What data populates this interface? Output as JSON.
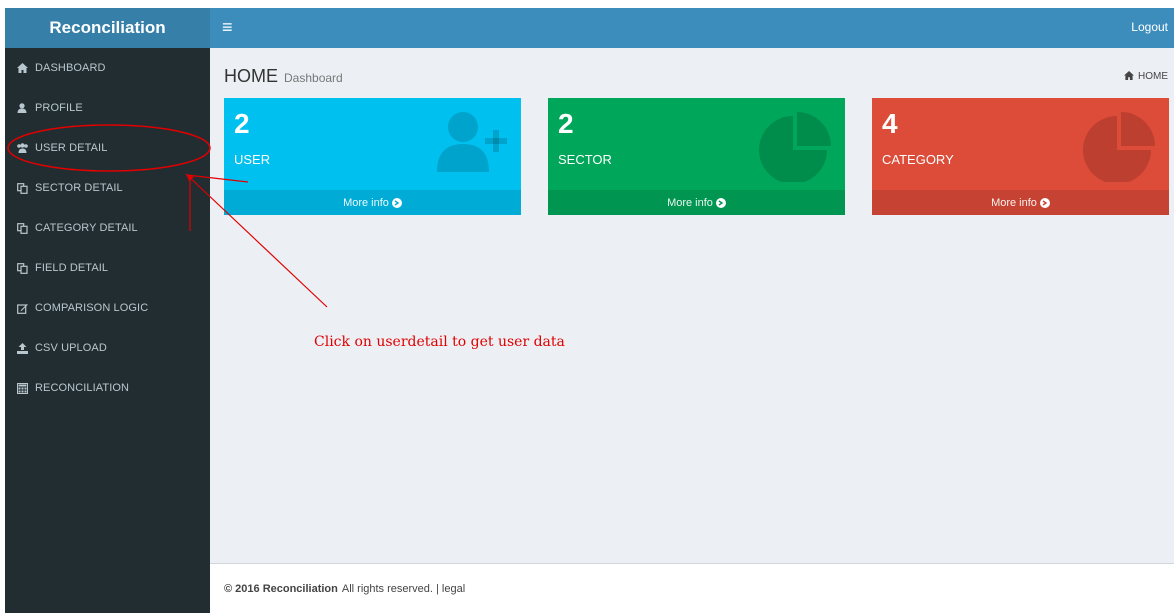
{
  "app": {
    "title": "Reconciliation"
  },
  "topbar": {
    "menu_icon": "hamburger-icon",
    "logout_label": "Logout"
  },
  "sidebar": {
    "items": [
      {
        "label": "DASHBOARD",
        "icon": "home-icon"
      },
      {
        "label": "PROFILE",
        "icon": "user-icon"
      },
      {
        "label": "USER DETAIL",
        "icon": "users-icon"
      },
      {
        "label": "SECTOR DETAIL",
        "icon": "copy-icon"
      },
      {
        "label": "CATEGORY DETAIL",
        "icon": "copy-icon"
      },
      {
        "label": "FIELD DETAIL",
        "icon": "copy-icon"
      },
      {
        "label": "COMPARISON LOGIC",
        "icon": "edit-icon"
      },
      {
        "label": "CSV UPLOAD",
        "icon": "upload-icon"
      },
      {
        "label": "RECONCILIATION",
        "icon": "calculator-icon"
      }
    ]
  },
  "header": {
    "title": "HOME",
    "subtitle": "Dashboard",
    "breadcrumb": "HOME"
  },
  "cards": [
    {
      "value": "2",
      "label": "USER",
      "more": "More info",
      "color": "#00c0ef",
      "icon": "user-plus-icon"
    },
    {
      "value": "2",
      "label": "SECTOR",
      "more": "More info",
      "color": "#00a65a",
      "icon": "pie-chart-icon"
    },
    {
      "value": "4",
      "label": "CATEGORY",
      "more": "More info",
      "color": "#dd4b39",
      "icon": "pie-chart-icon"
    }
  ],
  "annotation": {
    "text": "Click on userdetail to get user data",
    "color": "#e00000"
  },
  "footer": {
    "copyright": "© 2016 Reconciliation",
    "rights": "All rights reserved. | legal"
  }
}
